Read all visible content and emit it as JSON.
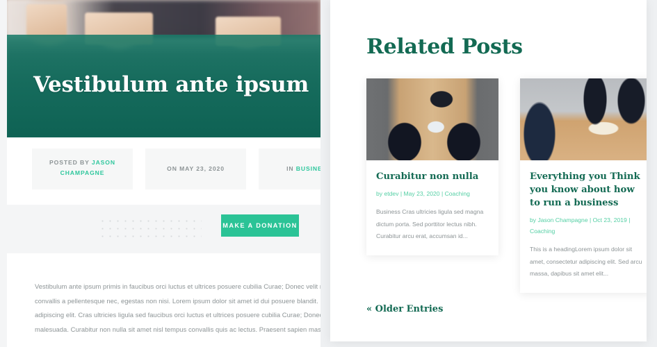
{
  "left": {
    "hero": {
      "title": "Vestibulum ante ipsum"
    },
    "meta": {
      "posted_by_prefix": "POSTED BY ",
      "author": "JASON CHAMPAGNE",
      "date": "ON MAY 23, 2020",
      "category_prefix": "IN ",
      "category": "BUSINESS"
    },
    "donate_button": "MAKE A DONATION",
    "body_text": "Vestibulum ante ipsum primis in faucibus orci luctus et ultrices posuere cubilia Curae; Donec velit neque ligula. Praesent sapien massa, convallis a pellentesque nec, egestas non nisi. Lorem ipsum dolor sit amet id dui posuere blandit. Lorem ipsum dolor sit amet, consectetur adipiscing elit. Cras ultricies ligula sed faucibus orci luctus et ultrices posuere cubilia Curae; Donec velit neque, auctor sit amet aliquam vel, malesuada. Curabitur non nulla sit amet nisl tempus convallis quis ac lectus. Praesent sapien massa,"
  },
  "right": {
    "heading": "Related Posts",
    "older_entries": "« Older Entries",
    "posts": [
      {
        "title": "Curabitur non nulla",
        "meta": "by etdev  |  May 23, 2020  |  Coaching",
        "excerpt": "Business Cras ultricies ligula sed magna dictum porta. Sed porttitor lectus nibh. Curabitur arcu erat, accumsan id...",
        "image_alt": "overhead-desk-tablets-photo"
      },
      {
        "title": "Everything you Think you know about how to run a business",
        "meta": "by Jason Champagne  |  Oct 23, 2019  |  Coaching",
        "excerpt": "This is a headingLorem ipsum dolor sit amet, consectetur adipiscing elit. Sed arcu massa, dapibus sit amet elit...",
        "image_alt": "business-meeting-ledger-photo"
      }
    ]
  },
  "colors": {
    "brand_green": "#2bc396",
    "dark_teal": "#136a53",
    "hero_overlay": "#127a68",
    "muted_text": "#8d9496",
    "meta_green": "#54cfa4"
  }
}
